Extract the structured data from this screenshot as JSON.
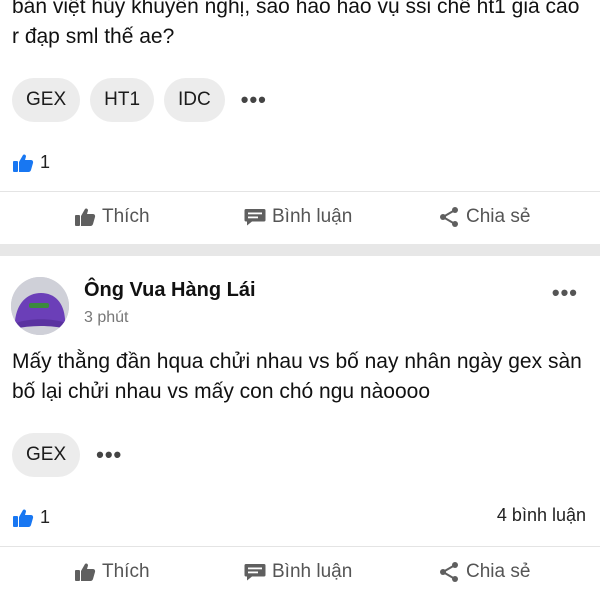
{
  "post1": {
    "body": "bản việt hủy khuyến nghị, sao hao hao vụ ssi chê ht1 giá cao r đạp sml thế ae?",
    "tags": [
      "GEX",
      "HT1",
      "IDC"
    ],
    "more": "•••",
    "likes": "1",
    "actions": {
      "like": "Thích",
      "comment": "Bình luận",
      "share": "Chia sẻ"
    }
  },
  "post2": {
    "author": "Ông Vua Hàng Lái",
    "time": "3 phút",
    "menu": "•••",
    "body": "Mấy thằng đần hqua chửi nhau vs bố nay nhân ngày gex sàn bố lại chửi nhau vs mấy con chó ngu nàoooo",
    "tags": [
      "GEX"
    ],
    "more": "•••",
    "likes": "1",
    "comments": "4 bình luận",
    "actions": {
      "like": "Thích",
      "comment": "Bình luận",
      "share": "Chia sẻ"
    }
  },
  "colors": {
    "like_blue": "#1877f2",
    "chip_bg": "#ececec",
    "separator": "#e7e7e7",
    "muted_text": "#555555",
    "avatar_cap": "#6b3fb8"
  }
}
